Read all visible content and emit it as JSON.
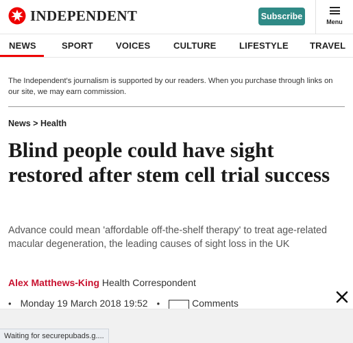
{
  "header": {
    "logo_text": "INDEPENDENT",
    "subscribe_label": "Subscribe",
    "menu_label": "Menu"
  },
  "nav": {
    "items": [
      "NEWS",
      "SPORT",
      "VOICES",
      "CULTURE",
      "LIFESTYLE",
      "TRAVEL"
    ],
    "active": "NEWS"
  },
  "disclaimer": "The Independent's journalism is supported by our readers. When you purchase through links on our site, we may earn commission.",
  "breadcrumb": {
    "section": "News",
    "separator": ">",
    "subsection": "Health"
  },
  "article": {
    "headline": "Blind people could have sight restored after stem cell trial success",
    "standfirst": "Advance could mean 'affordable off-the-shelf therapy' to treat age-related macular degeneration, the leading causes of sight loss in the UK",
    "author": "Alex Matthews-King",
    "author_role": "Health Correspondent",
    "date": "Monday 19 March 2018 19:52",
    "comments_label": "Comments"
  },
  "status_bar": "Waiting for securepubads.g....",
  "colors": {
    "accent_red": "#e00",
    "subscribe_teal": "#2f8a86",
    "author_red": "#c8102e"
  }
}
